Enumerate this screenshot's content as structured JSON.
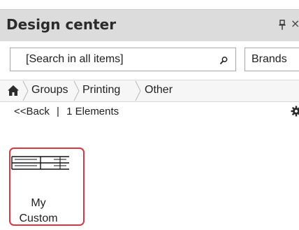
{
  "panel": {
    "title": "Design center",
    "pin_icon": "pin-icon",
    "close_glyph": "×"
  },
  "search": {
    "placeholder": "[Search in all items]",
    "icon": "search-icon"
  },
  "brands": {
    "label": "Brands"
  },
  "breadcrumb": {
    "home_icon": "home-icon",
    "items": [
      "Groups",
      "Printing",
      "Other"
    ]
  },
  "nav": {
    "back_label": "<<Back",
    "separator": "|",
    "count_label": "1 Elements",
    "settings_icon": "gear-icon"
  },
  "items": [
    {
      "label_line1": "My",
      "label_line2": "Custom",
      "selected": true
    }
  ],
  "colors": {
    "header_bg": "#dcdcdc",
    "selection_border": "#e0343f"
  }
}
